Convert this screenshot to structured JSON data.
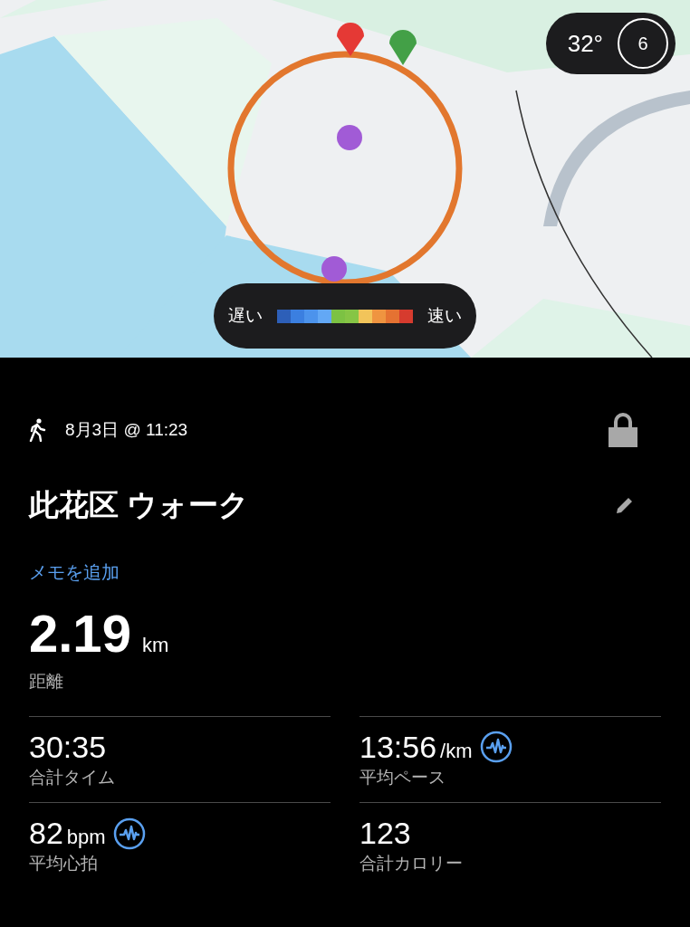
{
  "weather": {
    "temperature": "32°",
    "uv_index": "6"
  },
  "speed_legend": {
    "slow_label": "遅い",
    "fast_label": "速い",
    "swatches": [
      {
        "color": "#2d5fb8"
      },
      {
        "color": "#3b7fe0"
      },
      {
        "color": "#4c93ec"
      },
      {
        "color": "#63a8f5"
      },
      {
        "color": "#7cc243"
      },
      {
        "color": "#86c545"
      },
      {
        "color": "#f2c45a"
      },
      {
        "color": "#ef9440"
      },
      {
        "color": "#e57232"
      },
      {
        "color": "#d63b2e"
      }
    ]
  },
  "activity": {
    "date": "8月3日 @ 11:23",
    "locked": true,
    "title": "此花区 ウォーク",
    "add_note": "メモを追加"
  },
  "distance": {
    "value": "2.19",
    "unit": "km",
    "label": "距離"
  },
  "stats": [
    {
      "value": "30:35",
      "label": "合計タイム",
      "insight": false
    },
    {
      "value": "13:56",
      "unit": "/km",
      "label": "平均ペース",
      "insight": true
    },
    {
      "value": "82",
      "unit": "bpm",
      "label": "平均心拍",
      "insight": true
    },
    {
      "value": "123",
      "label": "合計カロリー",
      "insight": false
    }
  ]
}
